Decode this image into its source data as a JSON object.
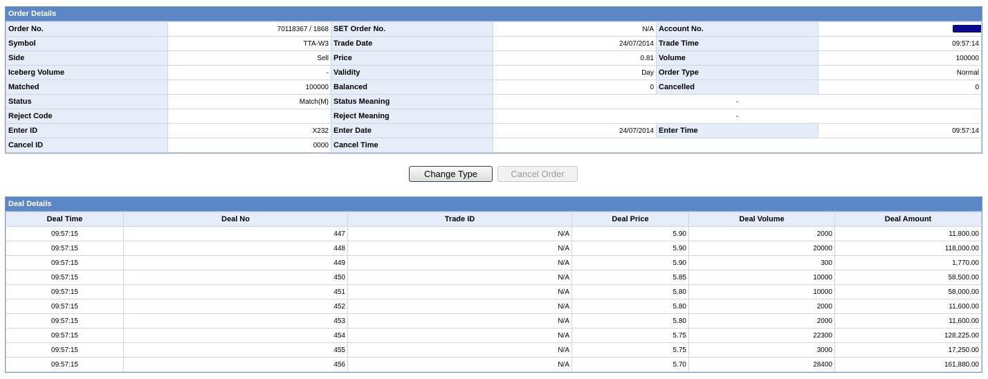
{
  "order": {
    "title": "Order Details",
    "rows": [
      [
        {
          "l": "Order No.",
          "v": "70118367 / 1868"
        },
        {
          "l": "SET Order No.",
          "v": "N/A"
        },
        {
          "l": "Account No.",
          "v": "",
          "redacted": true
        }
      ],
      [
        {
          "l": "Symbol",
          "v": "TTA-W3"
        },
        {
          "l": "Trade Date",
          "v": "24/07/2014"
        },
        {
          "l": "Trade Time",
          "v": "09:57:14"
        }
      ],
      [
        {
          "l": "Side",
          "v": "Sell"
        },
        {
          "l": "Price",
          "v": "0.81"
        },
        {
          "l": "Volume",
          "v": "100000"
        }
      ],
      [
        {
          "l": "Iceberg Volume",
          "v": "-"
        },
        {
          "l": "Validity",
          "v": "Day"
        },
        {
          "l": "Order Type",
          "v": "Normal"
        }
      ],
      [
        {
          "l": "Matched",
          "v": "100000"
        },
        {
          "l": "Balanced",
          "v": "0"
        },
        {
          "l": "Cancelled",
          "v": "0"
        }
      ],
      [
        {
          "l": "Status",
          "v": "Match(M)"
        },
        {
          "l": "Status Meaning",
          "v": "-",
          "wide": true
        }
      ],
      [
        {
          "l": "Reject Code",
          "v": ""
        },
        {
          "l": "Reject Meaning",
          "v": "-",
          "wide": true
        }
      ],
      [
        {
          "l": "Enter ID",
          "v": "X232"
        },
        {
          "l": "Enter Date",
          "v": "24/07/2014"
        },
        {
          "l": "Enter Time",
          "v": "09:57:14"
        }
      ],
      [
        {
          "l": "Cancel ID",
          "v": "0000"
        },
        {
          "l": "Cancel Time",
          "v": "",
          "wide": true
        }
      ]
    ]
  },
  "buttons": {
    "change_type": "Change Type",
    "cancel_order": "Cancel Order"
  },
  "deals": {
    "title": "Deal Details",
    "columns": [
      "Deal Time",
      "Deal No",
      "Trade ID",
      "Deal Price",
      "Deal Volume",
      "Deal Amount"
    ],
    "rows": [
      [
        "09:57:15",
        "447",
        "N/A",
        "5.90",
        "2000",
        "11,800.00"
      ],
      [
        "09:57:15",
        "448",
        "N/A",
        "5.90",
        "20000",
        "118,000.00"
      ],
      [
        "09:57:15",
        "449",
        "N/A",
        "5.90",
        "300",
        "1,770.00"
      ],
      [
        "09:57:15",
        "450",
        "N/A",
        "5.85",
        "10000",
        "58,500.00"
      ],
      [
        "09:57:15",
        "451",
        "N/A",
        "5.80",
        "10000",
        "58,000.00"
      ],
      [
        "09:57:15",
        "452",
        "N/A",
        "5.80",
        "2000",
        "11,600.00"
      ],
      [
        "09:57:15",
        "453",
        "N/A",
        "5.80",
        "2000",
        "11,600.00"
      ],
      [
        "09:57:15",
        "454",
        "N/A",
        "5.75",
        "22300",
        "128,225.00"
      ],
      [
        "09:57:15",
        "455",
        "N/A",
        "5.75",
        "3000",
        "17,250.00"
      ],
      [
        "09:57:15",
        "456",
        "N/A",
        "5.70",
        "28400",
        "161,880.00"
      ]
    ]
  }
}
